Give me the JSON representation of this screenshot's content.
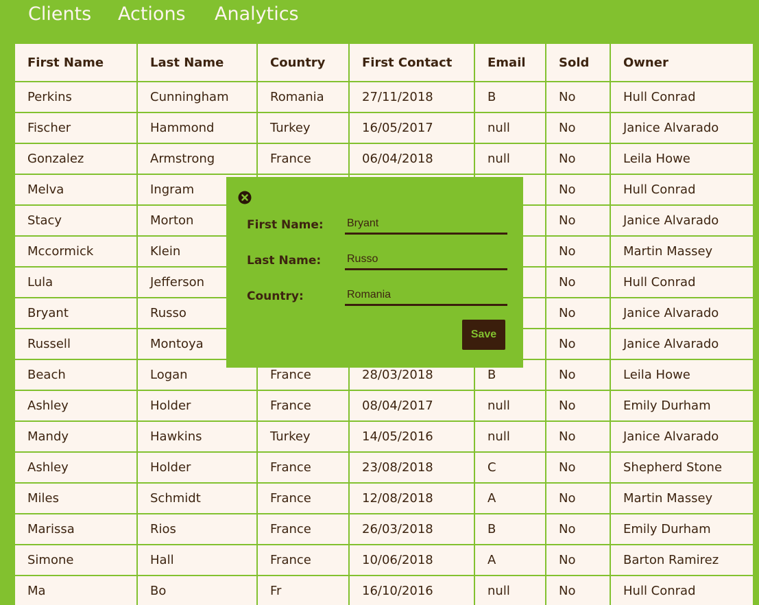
{
  "nav": {
    "items": [
      "Clients",
      "Actions",
      "Analytics"
    ]
  },
  "table": {
    "columns": [
      "First Name",
      "Last Name",
      "Country",
      "First Contact",
      "Email",
      "Sold",
      "Owner"
    ],
    "rows": [
      [
        "Perkins",
        "Cunningham",
        "Romania",
        "27/11/2018",
        "B",
        "No",
        "Hull Conrad"
      ],
      [
        "Fischer",
        "Hammond",
        "Turkey",
        "16/05/2017",
        "null",
        "No",
        "Janice Alvarado"
      ],
      [
        "Gonzalez",
        "Armstrong",
        "France",
        "06/04/2018",
        "null",
        "No",
        "Leila Howe"
      ],
      [
        "Melva",
        "Ingram",
        "",
        "",
        "",
        "No",
        "Hull Conrad"
      ],
      [
        "Stacy",
        "Morton",
        "",
        "",
        "",
        "No",
        "Janice Alvarado"
      ],
      [
        "Mccormick",
        "Klein",
        "",
        "",
        "",
        "No",
        "Martin Massey"
      ],
      [
        "Lula",
        "Jefferson",
        "",
        "",
        "",
        "No",
        "Hull Conrad"
      ],
      [
        "Bryant",
        "Russo",
        "",
        "",
        "",
        "No",
        "Janice Alvarado"
      ],
      [
        "Russell",
        "Montoya",
        "",
        "",
        "",
        "No",
        "Janice Alvarado"
      ],
      [
        "Beach",
        "Logan",
        "France",
        "28/03/2018",
        "B",
        "No",
        "Leila Howe"
      ],
      [
        "Ashley",
        "Holder",
        "France",
        "08/04/2017",
        "null",
        "No",
        "Emily Durham"
      ],
      [
        "Mandy",
        "Hawkins",
        "Turkey",
        "14/05/2016",
        "null",
        "No",
        "Janice Alvarado"
      ],
      [
        "Ashley",
        "Holder",
        "France",
        "23/08/2018",
        "C",
        "No",
        "Shepherd Stone"
      ],
      [
        "Miles",
        "Schmidt",
        "France",
        "12/08/2018",
        "A",
        "No",
        "Martin Massey"
      ],
      [
        "Marissa",
        "Rios",
        "France",
        "26/03/2018",
        "B",
        "No",
        "Emily Durham"
      ],
      [
        "Simone",
        "Hall",
        "France",
        "10/06/2018",
        "A",
        "No",
        "Barton Ramirez"
      ],
      [
        "Ma",
        "Bo",
        "Fr",
        "16/10/2016",
        "null",
        "No",
        "Hull Conrad"
      ]
    ]
  },
  "modal": {
    "close_icon": "close-circle-icon",
    "fields": [
      {
        "label": "First Name:",
        "value": "Bryant"
      },
      {
        "label": "Last Name:",
        "value": "Russo"
      },
      {
        "label": "Country:",
        "value": "Romania"
      }
    ],
    "save_label": "Save"
  },
  "colors": {
    "background": "#82c12f",
    "table_cell": "#fdf5ee",
    "text": "#3d2410",
    "button": "#3b1e0c"
  }
}
